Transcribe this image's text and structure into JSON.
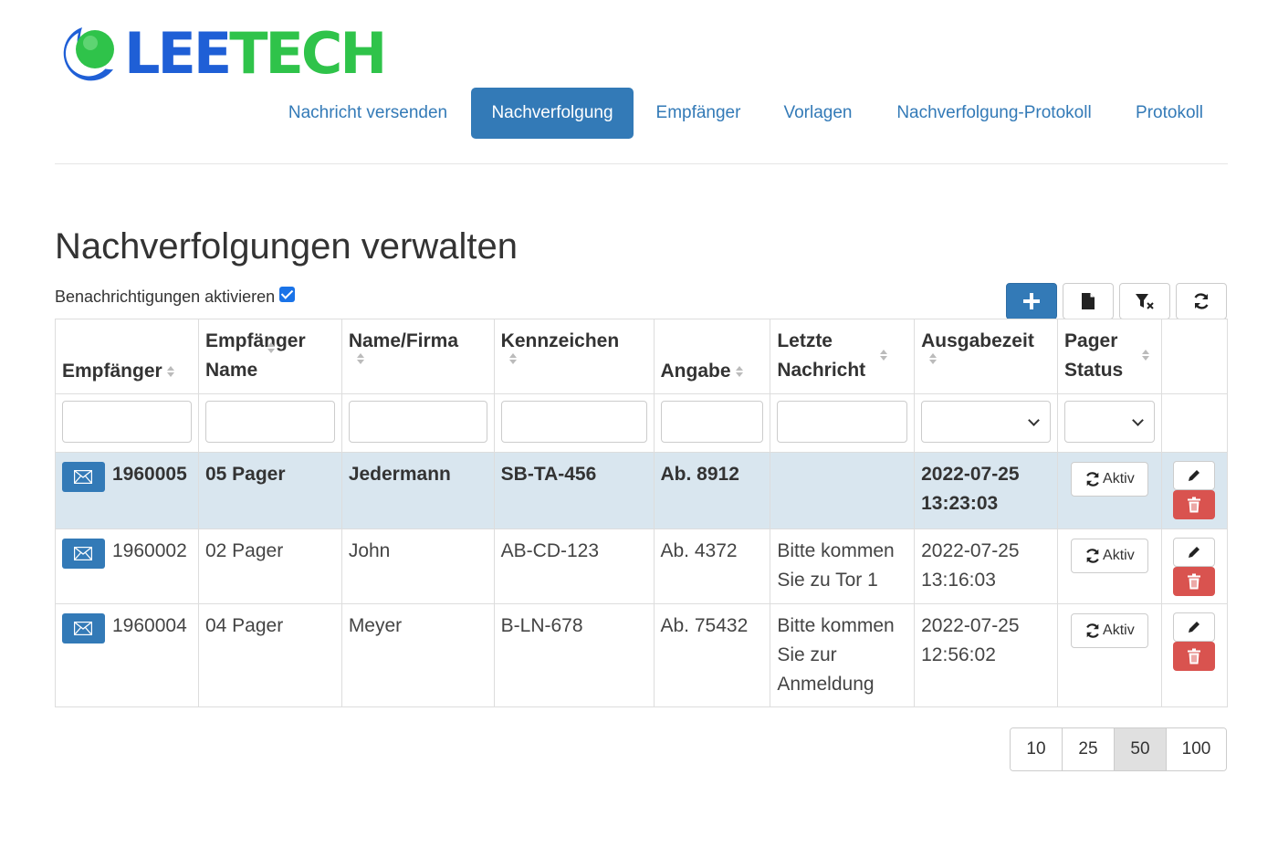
{
  "logo": {
    "part1": "LEE",
    "part2": "TECH"
  },
  "nav": {
    "items": [
      {
        "label": "Nachricht versenden"
      },
      {
        "label": "Nachverfolgung",
        "active": true
      },
      {
        "label": "Empfänger"
      },
      {
        "label": "Vorlagen"
      },
      {
        "label": "Nachverfolgung-Protokoll"
      },
      {
        "label": "Protokoll"
      }
    ]
  },
  "page": {
    "title": "Nachverfolgungen verwalten",
    "notifications_label": "Benachrichtigungen aktivieren",
    "notifications_checked": true
  },
  "toolbar": {
    "buttons": [
      {
        "icon": "plus-icon"
      },
      {
        "icon": "file-icon"
      },
      {
        "icon": "filter-clear-icon"
      },
      {
        "icon": "refresh-icon"
      }
    ]
  },
  "table": {
    "headers": {
      "empfaenger": "Empfänger",
      "empfaenger_name_1": "Empfänger",
      "empfaenger_name_2": "Name",
      "name_firma": "Name/Firma",
      "kennzeichen": "Kennzeichen",
      "angabe": "Angabe",
      "letzte_nachricht_1": "Letzte",
      "letzte_nachricht_2": "Nachricht",
      "ausgabezeit": "Ausgabezeit",
      "pager_status_1": "Pager",
      "pager_status_2": "Status"
    },
    "rows": [
      {
        "empfaenger": "1960005",
        "empfaenger_name": "05 Pager",
        "name_firma": "Jedermann",
        "kennzeichen": "SB-TA-456",
        "angabe": "Ab. 8912",
        "letzte_nachricht_1": "",
        "letzte_nachricht_2": "",
        "letzte_nachricht_3": "",
        "ausgabezeit_date": "2022-07-25",
        "ausgabezeit_time": "13:23:03",
        "status": "Aktiv",
        "selected": true
      },
      {
        "empfaenger": "1960002",
        "empfaenger_name": "02 Pager",
        "name_firma": "John",
        "kennzeichen": "AB-CD-123",
        "angabe": "Ab. 4372",
        "letzte_nachricht_1": "Bitte kommen",
        "letzte_nachricht_2": "Sie zu Tor 1",
        "letzte_nachricht_3": "",
        "ausgabezeit_date": "2022-07-25",
        "ausgabezeit_time": "13:16:03",
        "status": "Aktiv"
      },
      {
        "empfaenger": "1960004",
        "empfaenger_name": "04 Pager",
        "name_firma": "Meyer",
        "kennzeichen": "B-LN-678",
        "angabe": "Ab. 75432",
        "letzte_nachricht_1": "Bitte kommen",
        "letzte_nachricht_2": "Sie zur",
        "letzte_nachricht_3": "Anmeldung",
        "ausgabezeit_date": "2022-07-25",
        "ausgabezeit_time": "12:56:02",
        "status": "Aktiv"
      }
    ]
  },
  "pagination": {
    "sizes": [
      "10",
      "25",
      "50",
      "100"
    ],
    "active": "50"
  },
  "colors": {
    "primary": "#337ab7",
    "danger": "#d9534f",
    "selected_row": "#d9e6ef",
    "logo_blue": "#1f5fd6",
    "logo_green": "#2fc34a"
  }
}
